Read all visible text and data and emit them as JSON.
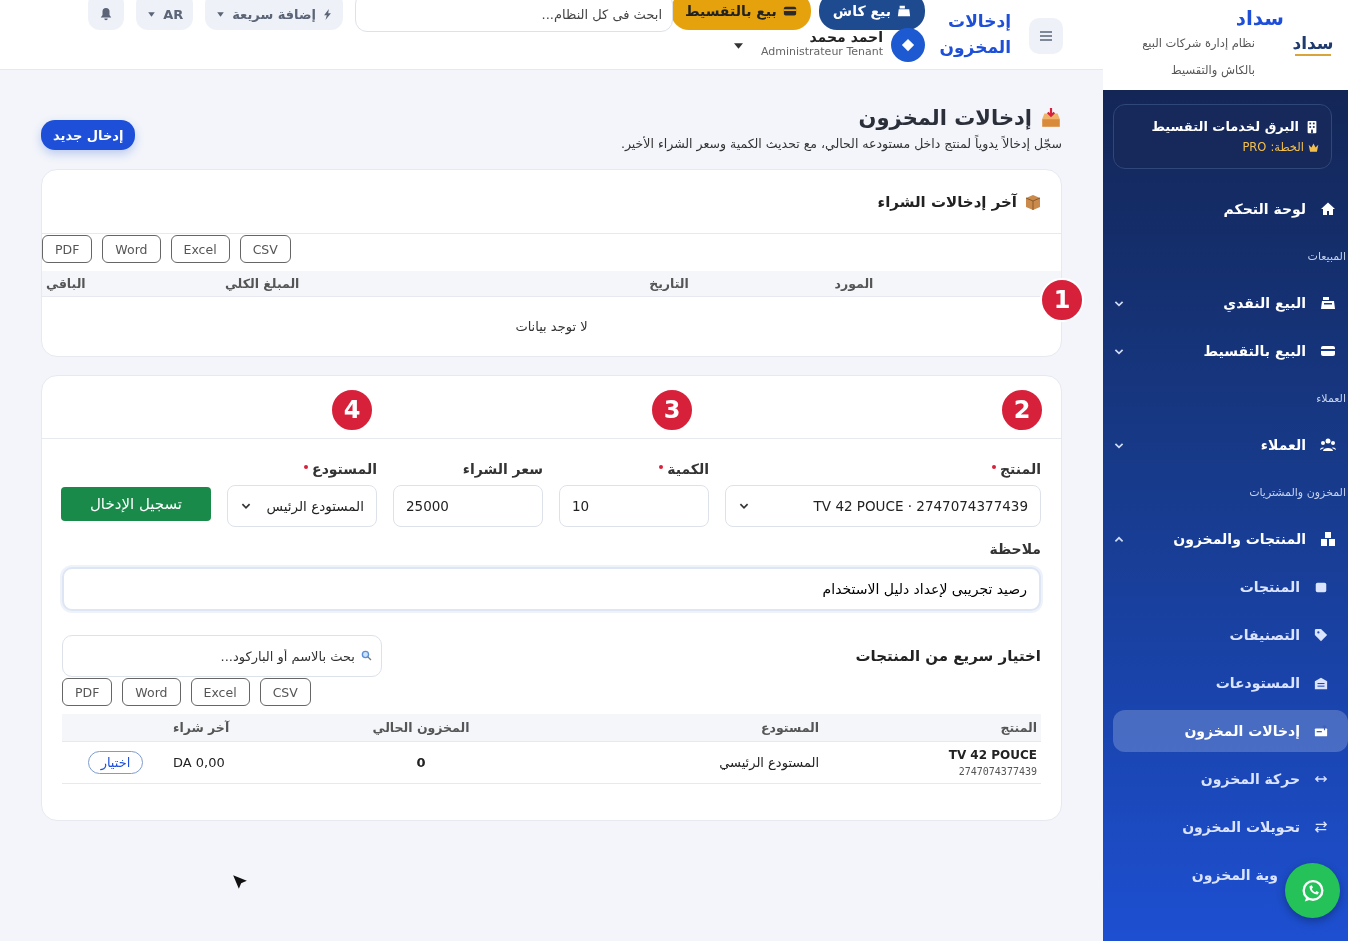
{
  "sidebar": {
    "brand": "سداد",
    "logo_text": "سداد",
    "tagline": "نظام إدارة شركات البيع بالكاش والتقسيط",
    "tenant": {
      "name": "البرق لخدمات التقسيط",
      "plan_label": "الخطة:",
      "plan": "PRO"
    },
    "nav": [
      {
        "kind": "item",
        "label": "لوحة التحكم",
        "selected": false
      },
      {
        "kind": "section",
        "label": "المبيعات"
      },
      {
        "kind": "item",
        "label": "البيع النقدي",
        "selected": false,
        "expanded": false
      },
      {
        "kind": "item",
        "label": "البيع بالتقسيط",
        "selected": false,
        "expanded": false
      },
      {
        "kind": "section",
        "label": "العملاء"
      },
      {
        "kind": "item",
        "label": "العملاء",
        "selected": false,
        "expanded": false
      },
      {
        "kind": "section",
        "label": "المخزون والمشتريات"
      },
      {
        "kind": "item",
        "label": "المنتجات والمخزون",
        "selected": false,
        "expanded": true,
        "children": [
          {
            "label": "المنتجات",
            "selected": false
          },
          {
            "label": "التصنيفات",
            "selected": false
          },
          {
            "label": "المستودعات",
            "selected": false
          },
          {
            "label": "إدخالات المخزون",
            "selected": true
          },
          {
            "label": "حركة المخزون",
            "selected": false
          },
          {
            "label": "تحويلات المخزون",
            "selected": false
          },
          {
            "label": "وية المخزون",
            "selected": false
          }
        ]
      }
    ]
  },
  "header": {
    "page_title": "إدخالات المخزون",
    "cash_sale": "بيع كاش",
    "installment_sale": "بيع بالتقسيط",
    "search": {
      "placeholder": "ابحث فى كل النظام..."
    },
    "quick_add": "إضافة سريعة",
    "language": "AR",
    "user": {
      "name": "احمد محمد",
      "role": "Administrateur Tenant"
    }
  },
  "page": {
    "title": "إدخالات المخزون",
    "subtitle": "سجّل إدخالاً يدوياً لمنتج داخل مستودعه الحالي، مع تحديث الكمية وسعر الشراء الأخير.",
    "new_button": "إدخال جديد"
  },
  "recent_card": {
    "title": "آخر إدخالات الشراء",
    "exports": [
      "CSV",
      "Excel",
      "Word",
      "PDF"
    ],
    "columns": [
      "المورد",
      "التاريخ",
      "المبلغ الكلي",
      "الباقي"
    ],
    "empty": "لا توجد بيانات"
  },
  "form": {
    "fields": [
      {
        "kind": "select",
        "label": "المنتج",
        "required": true,
        "value": "TV 42 POUCE · 2747074377439"
      },
      {
        "kind": "input",
        "label": "الكمية",
        "required": true,
        "value": "10"
      },
      {
        "kind": "input",
        "label": "سعر الشراء",
        "required": false,
        "value": "25000"
      },
      {
        "kind": "select",
        "label": "المستودع",
        "required": true,
        "value": "المستودع الرئيس"
      }
    ],
    "submit": "تسجيل الإدخال",
    "note": {
      "label": "ملاحظة",
      "value": "رصيد تجريبى لإعداد دليل الاستخدام"
    }
  },
  "quick_pick": {
    "title": "اختيار سريع من المنتجات",
    "search": {
      "placeholder": "بحث بالاسم أو الباركود..."
    },
    "exports": [
      "CSV",
      "Excel",
      "Word",
      "PDF"
    ],
    "columns": [
      "المنتج",
      "المستودع",
      "المخزون الحالي",
      "آخر شراء"
    ],
    "rows": [
      {
        "product": "TV 42 POUCE",
        "barcode": "2747074377439",
        "warehouse": "المستودع الرئيسي",
        "stock": "0",
        "last_price": "0,00 DA",
        "action": "اختيار"
      }
    ]
  },
  "markers": [
    "1",
    "2",
    "3",
    "4"
  ]
}
